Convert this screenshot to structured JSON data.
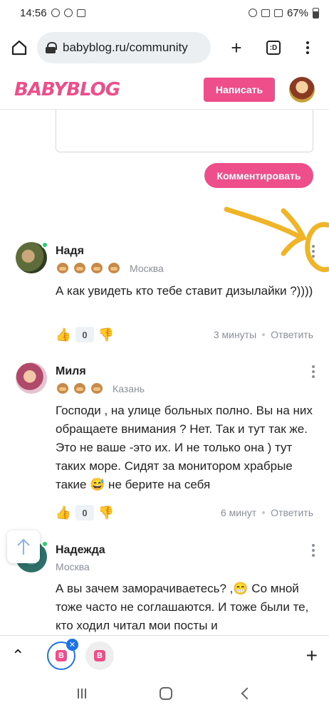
{
  "status": {
    "time": "14:56",
    "battery": "67%"
  },
  "browser": {
    "url": "babyblog.ru/community",
    "tab_count": ":D"
  },
  "site": {
    "logo": "BABYBLOG",
    "write_label": "Написать",
    "comment_button_label": "Комментировать"
  },
  "comments": [
    {
      "name": "Надя",
      "city": "Москва",
      "monkeys": 4,
      "text": "А как увидеть кто тебе ставит дизылайки ?))))",
      "likes": "0",
      "time": "3 минуты",
      "reply": "Ответить"
    },
    {
      "name": "Миля",
      "city": "Казань",
      "monkeys": 3,
      "text": "Господи , на улице больных полно. Вы на них обращаете внимания ? Нет. Так и тут так же. Это не ваше -это их. И не только она ) тут таких море. Сидят за монитором храбрые такие 😅 не берите на себя",
      "likes": "0",
      "time": "6 минут",
      "reply": "Ответить"
    },
    {
      "name": "Надежда",
      "city": "Москва",
      "monkeys": 0,
      "text": "А вы зачем заморачиваетесь? ,😁 Со мной тоже часто не соглашаются. И тоже были те, кто ходил читал мои посты и"
    }
  ],
  "colors": {
    "brand": "#ee4f8a",
    "annotation": "#f0b429",
    "online": "#2ecc71"
  }
}
